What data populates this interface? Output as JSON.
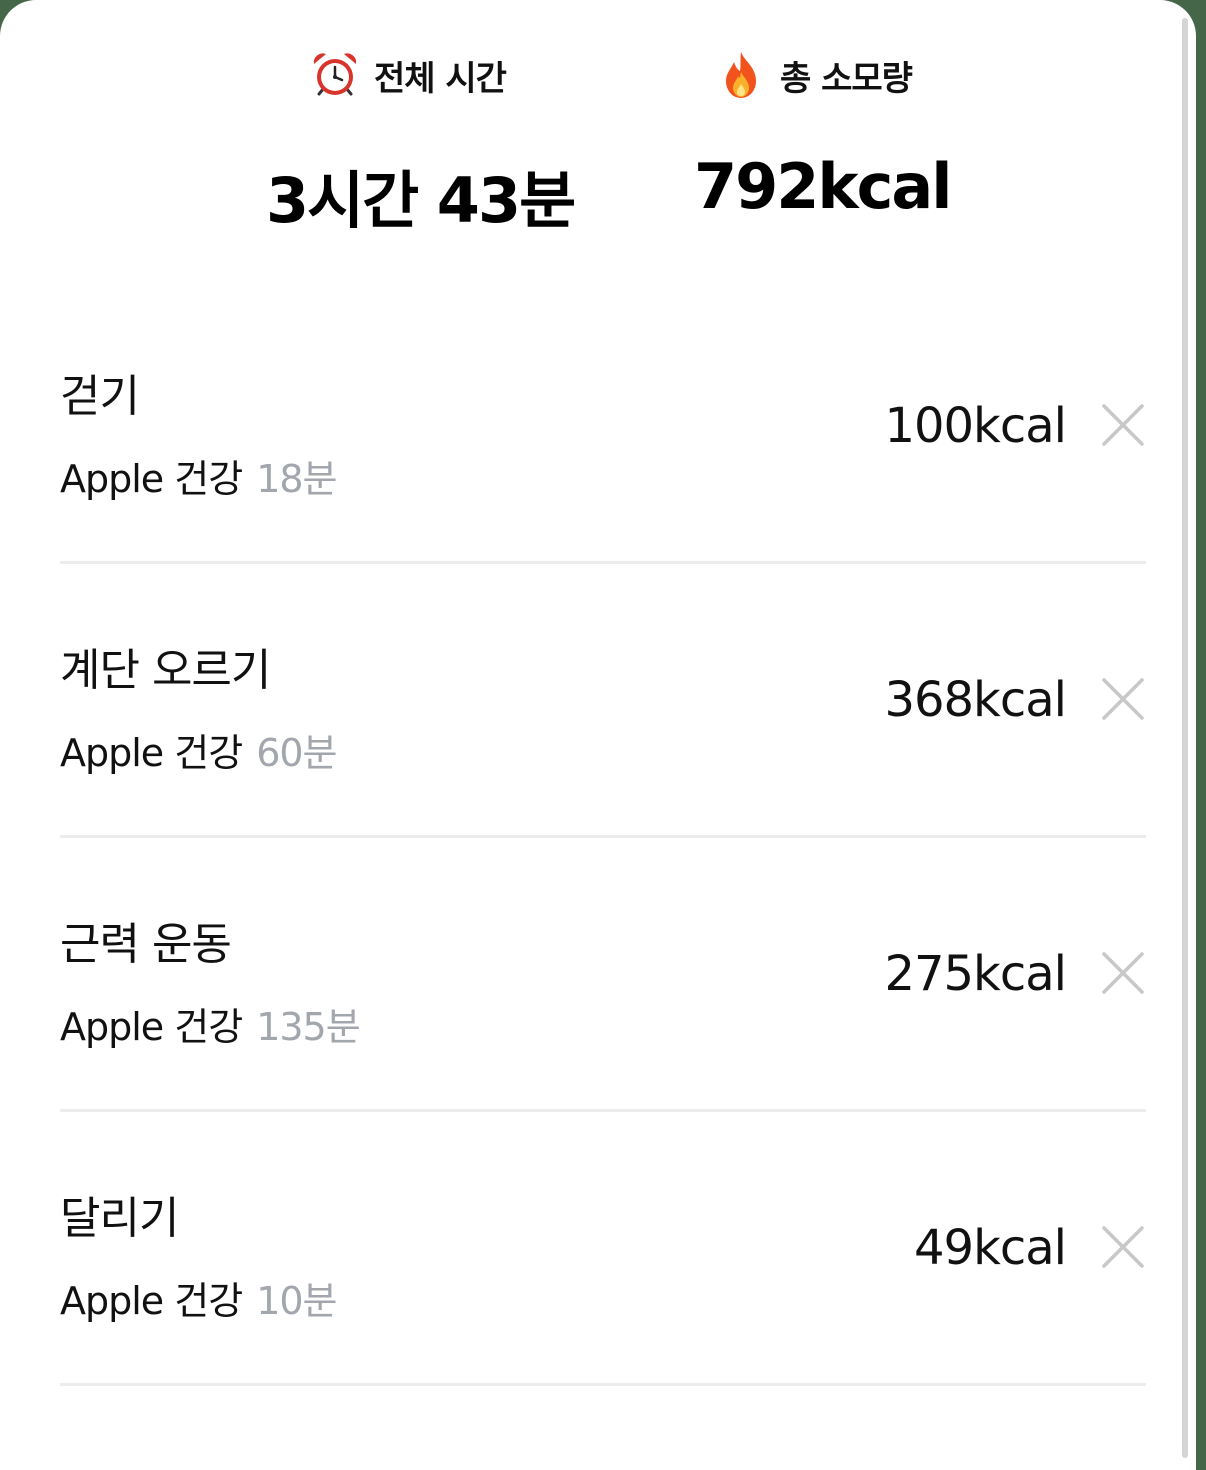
{
  "summary": {
    "total_time": {
      "icon": "alarm-clock-icon",
      "label": "전체 시간",
      "value": "3시간 43분"
    },
    "total_calories": {
      "icon": "fire-icon",
      "label": "총 소모량",
      "value": "792kcal"
    }
  },
  "activities": [
    {
      "name": "걷기",
      "source": "Apple 건강",
      "duration": "18분",
      "kcal": "100kcal"
    },
    {
      "name": "계단 오르기",
      "source": "Apple 건강",
      "duration": "60분",
      "kcal": "368kcal"
    },
    {
      "name": "근력 운동",
      "source": "Apple 건강",
      "duration": "135분",
      "kcal": "275kcal"
    },
    {
      "name": "달리기",
      "source": "Apple 건강",
      "duration": "10분",
      "kcal": "49kcal"
    }
  ],
  "colors": {
    "duration_text": "#a2a6ad",
    "divider": "#ececec",
    "delete_icon": "#c8c8c8",
    "backdrop": "#46664a"
  }
}
